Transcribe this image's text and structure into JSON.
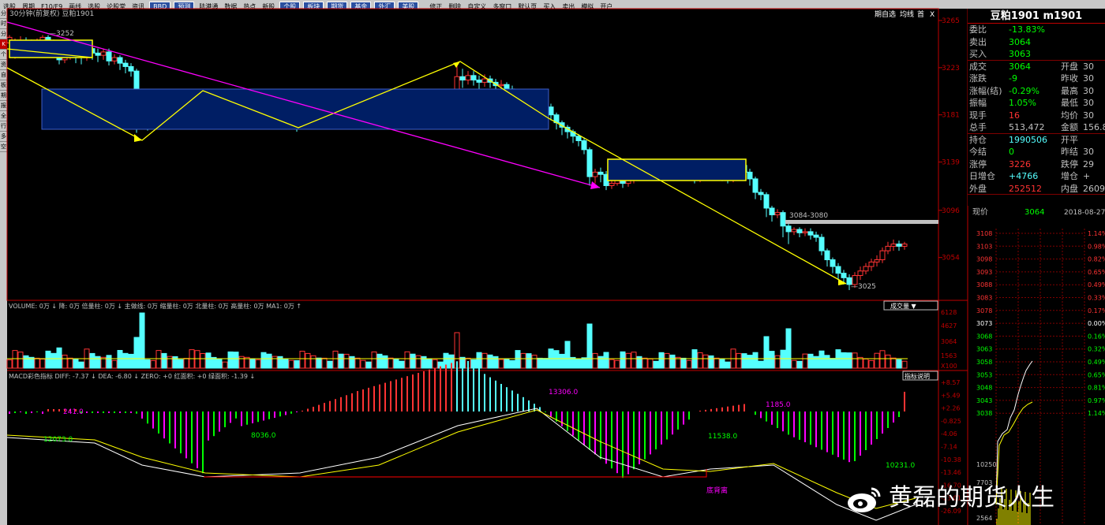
{
  "toolbar": [
    "选股",
    "周期",
    "F10/F9",
    "画线",
    "选股",
    "论股堂",
    "资讯",
    "BBD",
    "预测",
    "陆港通",
    "数据",
    "热点",
    "新股",
    "个股",
    "板块",
    "期货",
    "基金",
    "外汇",
    "美股",
    "",
    "修正",
    "删除",
    "自定义",
    "多窗口",
    "默认页",
    "买入",
    "卖出",
    "模拟",
    "开户"
  ],
  "sidebar_tabs": [
    "分",
    "时",
    "分析",
    "K线图",
    "个股",
    "资料",
    "自选",
    "板块",
    "期货",
    "报价",
    "全景",
    "行情",
    "多",
    "空"
  ],
  "chart": {
    "title": "30分钟(前复权) 豆粕1901",
    "top_right": [
      "期自选",
      "均线",
      "首",
      "X"
    ],
    "price_axis": [
      "3265",
      "3223",
      "3181",
      "3139",
      "3096",
      "3054"
    ],
    "annotations": {
      "high": "3252",
      "low": "3025",
      "range": "3084-3080"
    },
    "candles": [
      [
        12,
        3245,
        3250,
        3232,
        3252
      ],
      [
        19,
        3240,
        3246,
        3231,
        3249
      ],
      [
        26,
        3241,
        3247,
        3238,
        3251
      ],
      [
        33,
        3247,
        3244,
        3239,
        3250
      ],
      [
        40,
        3244,
        3241,
        3236,
        3248
      ],
      [
        47,
        3241,
        3245,
        3238,
        3249
      ],
      [
        54,
        3245,
        3250,
        3240,
        3252
      ],
      [
        61,
        3250,
        3246,
        3240,
        3252
      ],
      [
        68,
        3246,
        3243,
        3234,
        3248
      ],
      [
        75,
        3243,
        3230,
        3226,
        3246
      ],
      [
        82,
        3230,
        3235,
        3227,
        3238
      ],
      [
        89,
        3235,
        3238,
        3230,
        3241
      ],
      [
        96,
        3238,
        3234,
        3227,
        3241
      ],
      [
        103,
        3234,
        3232,
        3226,
        3237
      ],
      [
        110,
        3232,
        3240,
        3229,
        3243
      ],
      [
        117,
        3240,
        3236,
        3230,
        3242
      ],
      [
        124,
        3236,
        3234,
        3228,
        3240
      ],
      [
        131,
        3234,
        3237,
        3230,
        3240
      ],
      [
        138,
        3237,
        3229,
        3225,
        3240
      ],
      [
        145,
        3229,
        3232,
        3226,
        3235
      ],
      [
        152,
        3232,
        3227,
        3221,
        3234
      ],
      [
        159,
        3227,
        3224,
        3218,
        3230
      ],
      [
        166,
        3224,
        3220,
        3215,
        3227
      ],
      [
        173,
        3220,
        3190,
        3165,
        3222
      ],
      [
        180,
        3190,
        3175,
        3168,
        3195
      ],
      [
        187,
        3175,
        3172,
        3167,
        3180
      ],
      [
        194,
        3172,
        3176,
        3170,
        3180
      ],
      [
        201,
        3176,
        3182,
        3172,
        3185
      ],
      [
        208,
        3182,
        3178,
        3173,
        3186
      ],
      [
        215,
        3178,
        3180,
        3175,
        3184
      ],
      [
        222,
        3180,
        3176,
        3171,
        3183
      ],
      [
        229,
        3176,
        3174,
        3170,
        3181
      ],
      [
        236,
        3174,
        3180,
        3172,
        3184
      ],
      [
        243,
        3180,
        3186,
        3176,
        3189
      ],
      [
        250,
        3186,
        3193,
        3182,
        3197
      ],
      [
        257,
        3193,
        3198,
        3190,
        3201
      ],
      [
        264,
        3198,
        3190,
        3186,
        3202
      ],
      [
        271,
        3190,
        3186,
        3182,
        3194
      ],
      [
        278,
        3186,
        3182,
        3178,
        3189
      ],
      [
        285,
        3182,
        3184,
        3179,
        3188
      ],
      [
        292,
        3184,
        3180,
        3175,
        3187
      ],
      [
        299,
        3180,
        3174,
        3169,
        3184
      ],
      [
        306,
        3174,
        3176,
        3171,
        3180
      ],
      [
        313,
        3176,
        3179,
        3172,
        3182
      ],
      [
        320,
        3179,
        3176,
        3172,
        3183
      ],
      [
        327,
        3176,
        3180,
        3173,
        3184
      ],
      [
        334,
        3180,
        3178,
        3175,
        3184
      ],
      [
        341,
        3178,
        3176,
        3172,
        3181
      ],
      [
        348,
        3176,
        3177,
        3172,
        3180
      ],
      [
        355,
        3177,
        3174,
        3170,
        3180
      ],
      [
        362,
        3174,
        3172,
        3168,
        3177
      ],
      [
        369,
        3172,
        3174,
        3169,
        3178
      ],
      [
        376,
        3174,
        3170,
        3166,
        3177
      ],
      [
        383,
        3170,
        3175,
        3168,
        3178
      ],
      [
        390,
        3175,
        3179,
        3173,
        3182
      ],
      [
        397,
        3179,
        3182,
        3176,
        3185
      ],
      [
        404,
        3182,
        3180,
        3177,
        3185
      ],
      [
        411,
        3180,
        3184,
        3178,
        3187
      ],
      [
        418,
        3184,
        3182,
        3178,
        3186
      ],
      [
        425,
        3182,
        3186,
        3180,
        3190
      ],
      [
        432,
        3186,
        3184,
        3181,
        3189
      ],
      [
        439,
        3184,
        3188,
        3182,
        3191
      ],
      [
        446,
        3188,
        3185,
        3182,
        3191
      ],
      [
        453,
        3185,
        3188,
        3183,
        3192
      ],
      [
        460,
        3188,
        3190,
        3186,
        3193
      ],
      [
        467,
        3190,
        3188,
        3185,
        3193
      ],
      [
        474,
        3188,
        3192,
        3186,
        3195
      ],
      [
        481,
        3192,
        3189,
        3186,
        3194
      ],
      [
        488,
        3189,
        3186,
        3183,
        3192
      ],
      [
        495,
        3186,
        3188,
        3183,
        3191
      ],
      [
        502,
        3188,
        3185,
        3180,
        3190
      ],
      [
        509,
        3185,
        3183,
        3178,
        3188
      ],
      [
        516,
        3183,
        3186,
        3180,
        3190
      ],
      [
        523,
        3186,
        3184,
        3180,
        3189
      ],
      [
        530,
        3184,
        3186,
        3182,
        3190
      ],
      [
        537,
        3186,
        3183,
        3179,
        3189
      ],
      [
        544,
        3183,
        3181,
        3176,
        3186
      ],
      [
        551,
        3181,
        3184,
        3178,
        3187
      ],
      [
        558,
        3184,
        3182,
        3178,
        3186
      ],
      [
        565,
        3182,
        3180,
        3177,
        3185
      ],
      [
        572,
        3180,
        3178,
        3175,
        3183
      ],
      [
        579,
        3178,
        3215,
        3176,
        3225
      ],
      [
        586,
        3215,
        3212,
        3205,
        3222
      ],
      [
        593,
        3212,
        3216,
        3208,
        3220
      ],
      [
        600,
        3216,
        3212,
        3207,
        3220
      ],
      [
        607,
        3212,
        3210,
        3204,
        3216
      ],
      [
        614,
        3210,
        3213,
        3206,
        3217
      ],
      [
        621,
        3213,
        3210,
        3205,
        3216
      ],
      [
        628,
        3210,
        3207,
        3202,
        3213
      ],
      [
        635,
        3207,
        3208,
        3203,
        3212
      ],
      [
        642,
        3208,
        3204,
        3199,
        3210
      ],
      [
        649,
        3204,
        3200,
        3195,
        3207
      ],
      [
        656,
        3200,
        3194,
        3189,
        3203
      ],
      [
        663,
        3194,
        3198,
        3191,
        3202
      ],
      [
        670,
        3198,
        3192,
        3188,
        3201
      ],
      [
        677,
        3192,
        3198,
        3190,
        3202
      ],
      [
        684,
        3198,
        3194,
        3188,
        3201
      ],
      [
        691,
        3194,
        3188,
        3183,
        3197
      ],
      [
        698,
        3188,
        3181,
        3176,
        3191
      ],
      [
        705,
        3181,
        3174,
        3168,
        3183
      ],
      [
        712,
        3174,
        3170,
        3163,
        3176
      ],
      [
        719,
        3170,
        3166,
        3160,
        3172
      ],
      [
        726,
        3166,
        3162,
        3156,
        3168
      ],
      [
        733,
        3162,
        3158,
        3153,
        3164
      ],
      [
        740,
        3158,
        3150,
        3146,
        3161
      ],
      [
        747,
        3150,
        3126,
        3118,
        3152
      ],
      [
        754,
        3126,
        3130,
        3120,
        3133
      ],
      [
        761,
        3130,
        3128,
        3121,
        3134
      ],
      [
        768,
        3128,
        3118,
        3114,
        3131
      ],
      [
        775,
        3118,
        3120,
        3115,
        3124
      ],
      [
        782,
        3120,
        3123,
        3118,
        3126
      ],
      [
        789,
        3123,
        3120,
        3116,
        3126
      ],
      [
        796,
        3120,
        3123,
        3117,
        3126
      ],
      [
        803,
        3123,
        3130,
        3120,
        3133
      ],
      [
        810,
        3130,
        3127,
        3124,
        3134
      ],
      [
        817,
        3127,
        3130,
        3125,
        3133
      ],
      [
        824,
        3130,
        3134,
        3128,
        3137
      ],
      [
        831,
        3134,
        3131,
        3127,
        3141
      ],
      [
        838,
        3131,
        3128,
        3125,
        3135
      ],
      [
        845,
        3128,
        3132,
        3125,
        3135
      ],
      [
        852,
        3132,
        3128,
        3124,
        3135
      ],
      [
        859,
        3128,
        3131,
        3125,
        3134
      ],
      [
        866,
        3131,
        3127,
        3123,
        3134
      ],
      [
        873,
        3127,
        3130,
        3123,
        3133
      ],
      [
        880,
        3130,
        3124,
        3120,
        3133
      ],
      [
        887,
        3124,
        3128,
        3121,
        3131
      ],
      [
        894,
        3128,
        3131,
        3125,
        3134
      ],
      [
        901,
        3131,
        3127,
        3123,
        3134
      ],
      [
        908,
        3127,
        3130,
        3124,
        3133
      ],
      [
        915,
        3130,
        3126,
        3122,
        3133
      ],
      [
        922,
        3126,
        3124,
        3120,
        3131
      ],
      [
        929,
        3124,
        3132,
        3121,
        3140
      ],
      [
        936,
        3132,
        3136,
        3128,
        3140
      ],
      [
        943,
        3136,
        3130,
        3125,
        3139
      ],
      [
        950,
        3130,
        3124,
        3118,
        3133
      ],
      [
        957,
        3124,
        3112,
        3106,
        3126
      ],
      [
        964,
        3112,
        3110,
        3105,
        3115
      ],
      [
        971,
        3110,
        3098,
        3090,
        3112
      ],
      [
        978,
        3098,
        3092,
        3086,
        3100
      ],
      [
        985,
        3092,
        3094,
        3089,
        3097
      ],
      [
        992,
        3094,
        3082,
        3072,
        3096
      ],
      [
        999,
        3082,
        3077,
        3066,
        3085
      ],
      [
        1006,
        3077,
        3079,
        3074,
        3081
      ],
      [
        1013,
        3079,
        3076,
        3072,
        3081
      ],
      [
        1020,
        3076,
        3077,
        3073,
        3080
      ],
      [
        1027,
        3077,
        3074,
        3070,
        3080
      ],
      [
        1034,
        3074,
        3072,
        3068,
        3077
      ],
      [
        1041,
        3072,
        3060,
        3056,
        3075
      ],
      [
        1048,
        3060,
        3052,
        3046,
        3062
      ],
      [
        1055,
        3052,
        3046,
        3040,
        3054
      ],
      [
        1062,
        3046,
        3040,
        3034,
        3049
      ],
      [
        1069,
        3040,
        3036,
        3030,
        3043
      ],
      [
        1076,
        3036,
        3030,
        3025,
        3039
      ],
      [
        1083,
        3030,
        3038,
        3027,
        3041
      ],
      [
        1090,
        3038,
        3042,
        3034,
        3046
      ],
      [
        1097,
        3042,
        3046,
        3039,
        3049
      ],
      [
        1104,
        3046,
        3050,
        3042,
        3053
      ],
      [
        1111,
        3050,
        3052,
        3046,
        3056
      ],
      [
        1118,
        3052,
        3060,
        3049,
        3063
      ],
      [
        1125,
        3060,
        3064,
        3057,
        3068
      ],
      [
        1132,
        3064,
        3066,
        3060,
        3070
      ],
      [
        1139,
        3066,
        3064,
        3060,
        3069
      ],
      [
        1146,
        3064,
        3066,
        3061,
        3068
      ]
    ],
    "volume_bar": "VOLUME: 0万 ↓ 降: 0万 倍量柱: 0万 ↓ 主做线: 0万 缩量柱: 0万 北量柱: 0万 高量柱: 0万 MA1: 0万 ↑",
    "volume_select": "成交量",
    "volume_axis": [
      "6128",
      "4627",
      "3064",
      "1563",
      "X100"
    ],
    "macd_bar": "MACD彩色指标 DIFF: -7.37 ↓ DEA: -6.80 ↓ ZERO: +0 红面积: +0 绿面积: -1.39 ↓",
    "macd_btn": "指标说明",
    "macd_axis": [
      "+8.57",
      "+5.49",
      "+2.26",
      "-0.825",
      "-4.06",
      "-7.14",
      "-10.38",
      "-13.46",
      "-16.70",
      "-23.01",
      "-26.09"
    ],
    "macd_labels": {
      "a": "241.0",
      "b": "8036.0",
      "c": "13306.0",
      "d": "1185.0",
      "e": "11538.0",
      "f": "10231.0",
      "g": "12073.0",
      "div": "底背离"
    }
  },
  "quote": {
    "title": "豆粕1901 m1901",
    "rows": [
      [
        "委比",
        "-13.83%",
        "",
        ""
      ],
      [
        "卖出",
        "3064",
        "",
        ""
      ],
      [
        "买入",
        "3063",
        "",
        ""
      ],
      [
        "成交",
        "3064",
        "开盘",
        "30"
      ],
      [
        "涨跌",
        "-9",
        "昨收",
        "30"
      ],
      [
        "涨幅(结)",
        "-0.29%",
        "最高",
        "30"
      ],
      [
        "振幅",
        "1.05%",
        "最低",
        "30"
      ],
      [
        "现手",
        "16",
        "均价",
        "30"
      ],
      [
        "总手",
        "513,472",
        "金额",
        "156.8"
      ],
      [
        "持仓",
        "1990506",
        "开平",
        ""
      ],
      [
        "今结",
        "0",
        "昨结",
        "30"
      ],
      [
        "涨停",
        "3226",
        "跌停",
        "29"
      ],
      [
        "日增仓",
        "+4766",
        "增仓",
        "+"
      ],
      [
        "外盘",
        "252512",
        "内盘",
        "26090"
      ]
    ],
    "price_label": "现价",
    "price_value": "3064",
    "date": "2018-08-27,",
    "mini_axis_left": [
      "3108",
      "3103",
      "3098",
      "3093",
      "3088",
      "3083",
      "3078",
      "3073",
      "3068",
      "3063",
      "3058",
      "3053",
      "3048",
      "3043",
      "3038",
      "10250",
      "7703",
      "2564"
    ],
    "mini_axis_right": [
      "1.14%",
      "0.98%",
      "0.82%",
      "0.65%",
      "0.49%",
      "0.33%",
      "0.17%",
      "0.00%",
      "0.16%",
      "0.32%",
      "0.49%",
      "0.65%",
      "0.81%",
      "0.97%",
      "1.14%"
    ]
  },
  "watermark": "黄磊的期货人生",
  "colors": {
    "up": "#ff3333",
    "down": "#55ffff",
    "yellow": "#ffff00",
    "magenta": "#ff00ff",
    "grid": "#800000",
    "blue": "#001e64"
  }
}
